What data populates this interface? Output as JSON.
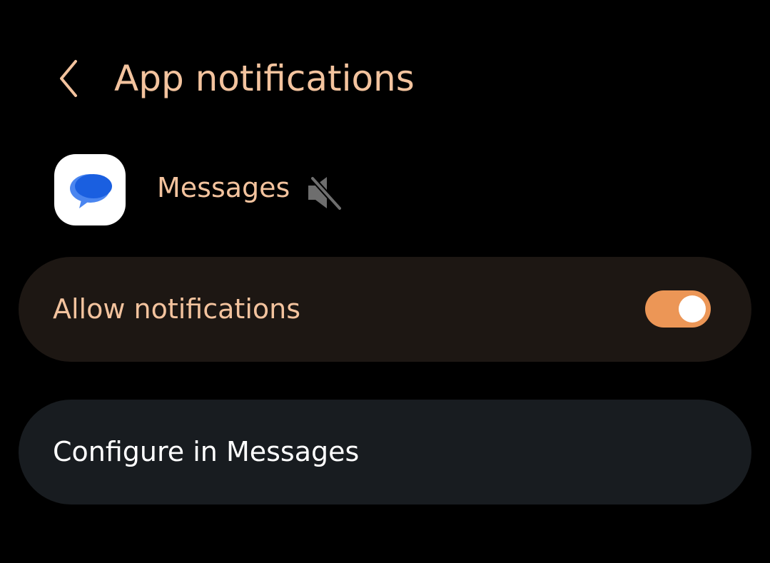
{
  "header": {
    "title": "App notifications",
    "back_icon": "chevron-left-icon"
  },
  "app": {
    "name": "Messages",
    "icon": "messages-app-icon",
    "status_icon": "muted-speaker-icon"
  },
  "allow_notifications": {
    "label": "Allow notifications",
    "enabled": true
  },
  "configure": {
    "label": "Configure in Messages"
  },
  "colors": {
    "background": "#000000",
    "accent_text": "#f3c39e",
    "toggle_on": "#ec9656",
    "card_allow_bg": "#1d1713",
    "card_config_bg": "#181c20",
    "brand_blue": "#1a5fe0"
  }
}
